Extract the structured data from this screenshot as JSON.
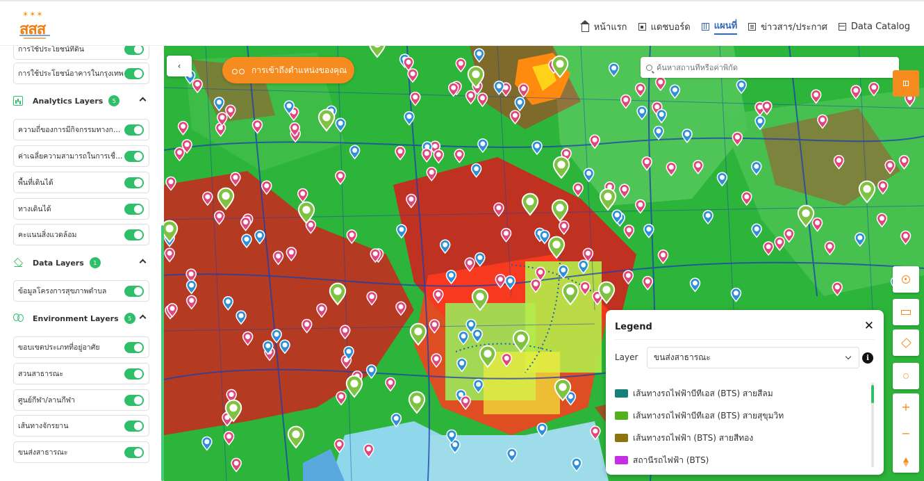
{
  "header": {
    "logo_text": "สสส",
    "nav": [
      {
        "label": "หน้าแรก",
        "icon": "home-icon"
      },
      {
        "label": "แดชบอร์ด",
        "icon": "dashboard-icon"
      },
      {
        "label": "แผนที่",
        "icon": "map-icon",
        "active": true
      },
      {
        "label": "ข่าวสาร/ประกาศ",
        "icon": "news-icon"
      },
      {
        "label": "Data Catalog",
        "icon": "catalog-icon"
      }
    ]
  },
  "sidebar": {
    "top_layers": [
      "การใช้ประโยชน์ที่ดิน",
      "การใช้ประโยชน์อาคารในกรุงเทพ"
    ],
    "analytics": {
      "title": "Analytics Layers",
      "count": "5",
      "items": [
        "ความถี่ของการมีกิจกรรมทางกาย...",
        "ค่าเฉลี่ยความสามารถในการเชื่อม...",
        "พื้นที่เดินได้",
        "ทางเดินได้",
        "คะแนนสิ่งแวดล้อม"
      ]
    },
    "data": {
      "title": "Data Layers",
      "count": "1",
      "items": [
        "ข้อมูลโครงการสุขภาพตำบล"
      ]
    },
    "environment": {
      "title": "Environment Layers",
      "count": "5",
      "items": [
        "ขอบเขตประเภทที่อยู่อาศัย",
        "สวนสาธารณะ",
        "ศูนย์กีฬา/ลานกีฬา",
        "เส้นทางจักรยาน",
        "ขนส่งสาธารณะ"
      ]
    }
  },
  "map": {
    "collapse_label": "‹",
    "locate_label": "การเข้าถึงตำแหน่งของคุณ",
    "search_placeholder": "ค้นหาสถานที่หรือค่าพิกัด",
    "colors": {
      "accent": "#f68b1f",
      "toggle": "#2fbf6b",
      "map_green": "#2db43a",
      "urban_red": "#e3121b",
      "water": "#8fd8ec"
    }
  },
  "legend": {
    "title": "Legend",
    "close": "✕",
    "layer_label": "Layer",
    "selected_layer": "ขนส่งสาธารณะ",
    "info": "i",
    "items": [
      {
        "label": "เส้นทางรถไฟฟ้าบีทีเอส (BTS) สายสีลม",
        "color": "#16807a"
      },
      {
        "label": "เส้นทางรถไฟฟ้าบีทีเอส (BTS) สายสุขุมวิท",
        "color": "#52b21e"
      },
      {
        "label": "เส้นทางรถไฟฟ้า (BTS) สายสีทอง",
        "color": "#8d7411"
      },
      {
        "label": "สถานีรถไฟฟ้า (BTS)",
        "color": "#c62ee3"
      }
    ]
  }
}
